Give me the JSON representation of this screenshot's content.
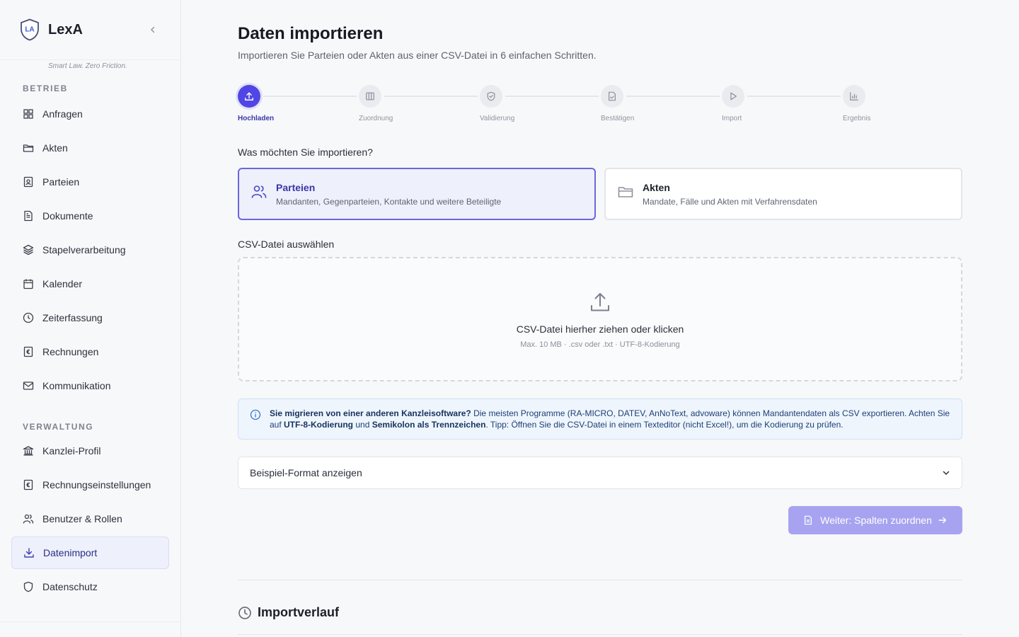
{
  "brand": {
    "initials": "LA",
    "name": "LexA",
    "tagline": "Smart Law. Zero Friction."
  },
  "sidebar": {
    "sections": [
      {
        "title": "BETRIEB",
        "items": [
          {
            "label": "Anfragen",
            "icon": "grid-icon"
          },
          {
            "label": "Akten",
            "icon": "folder-icon"
          },
          {
            "label": "Parteien",
            "icon": "contact-card-icon"
          },
          {
            "label": "Dokumente",
            "icon": "document-icon"
          },
          {
            "label": "Stapelverarbeitung",
            "icon": "layers-icon"
          },
          {
            "label": "Kalender",
            "icon": "calendar-icon"
          },
          {
            "label": "Zeiterfassung",
            "icon": "clock-icon"
          },
          {
            "label": "Rechnungen",
            "icon": "invoice-icon"
          },
          {
            "label": "Kommunikation",
            "icon": "mail-icon"
          }
        ]
      },
      {
        "title": "VERWALTUNG",
        "items": [
          {
            "label": "Kanzlei-Profil",
            "icon": "bank-icon"
          },
          {
            "label": "Rechnungseinstellungen",
            "icon": "invoice-icon"
          },
          {
            "label": "Benutzer & Rollen",
            "icon": "users-icon"
          },
          {
            "label": "Datenimport",
            "icon": "download-icon",
            "active": true
          },
          {
            "label": "Datenschutz",
            "icon": "shield-icon"
          }
        ]
      }
    ]
  },
  "page": {
    "title": "Daten importieren",
    "subtitle": "Importieren Sie Parteien oder Akten aus einer CSV-Datei in 6 einfachen Schritten."
  },
  "stepper": {
    "steps": [
      {
        "label": "Hochladen",
        "icon": "upload-icon",
        "active": true
      },
      {
        "label": "Zuordnung",
        "icon": "columns-icon"
      },
      {
        "label": "Validierung",
        "icon": "shield-check-icon"
      },
      {
        "label": "Bestätigen",
        "icon": "file-check-icon"
      },
      {
        "label": "Import",
        "icon": "play-icon"
      },
      {
        "label": "Ergebnis",
        "icon": "bar-chart-icon"
      }
    ]
  },
  "import_type": {
    "question": "Was möchten Sie importieren?",
    "options": [
      {
        "title": "Parteien",
        "description": "Mandanten, Gegenparteien, Kontakte und weitere Beteiligte",
        "icon": "users-icon",
        "selected": true
      },
      {
        "title": "Akten",
        "description": "Mandate, Fälle und Akten mit Verfahrensdaten",
        "icon": "folder-icon",
        "selected": false
      }
    ]
  },
  "upload": {
    "label": "CSV-Datei auswählen",
    "title": "CSV-Datei hierher ziehen oder klicken",
    "hint": "Max. 10 MB · .csv oder .txt · UTF-8-Kodierung"
  },
  "info": {
    "lead": "Sie migrieren von einer anderen Kanzleisoftware?",
    "text1": " Die meisten Programme (RA-MICRO, DATEV, AnNoText, advoware) können Mandantendaten als CSV exportieren. Achten Sie auf ",
    "bold1": "UTF-8-Kodierung",
    "text2": " und ",
    "bold2": "Semikolon als Trennzeichen",
    "text3": ". Tipp: Öffnen Sie die CSV-Datei in einem Texteditor (nicht Excel!), um die Kodierung zu prüfen."
  },
  "example": {
    "label": "Beispiel-Format anzeigen"
  },
  "actions": {
    "next_label": "Weiter: Spalten zuordnen"
  },
  "history": {
    "title": "Importverlauf"
  },
  "colors": {
    "accent": "#4f46e5",
    "accent_disabled": "#a8a3f0",
    "info_bg": "#eef5fd"
  }
}
